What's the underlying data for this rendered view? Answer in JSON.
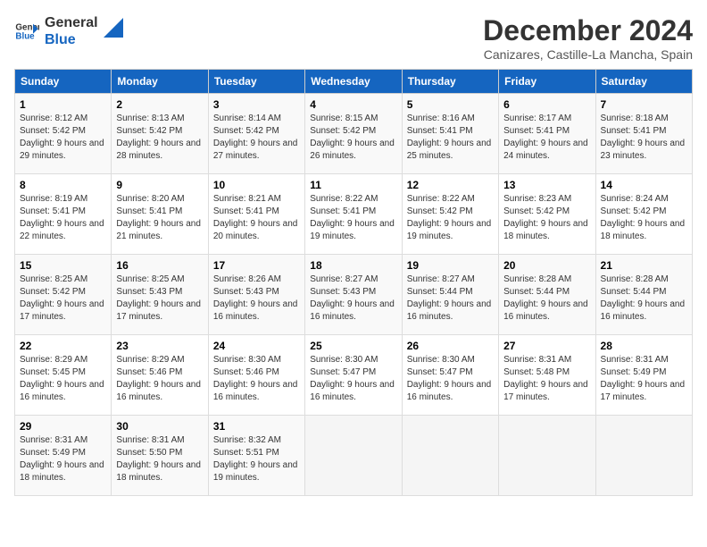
{
  "logo": {
    "line1": "General",
    "line2": "Blue"
  },
  "title": "December 2024",
  "subtitle": "Canizares, Castille-La Mancha, Spain",
  "days_header": [
    "Sunday",
    "Monday",
    "Tuesday",
    "Wednesday",
    "Thursday",
    "Friday",
    "Saturday"
  ],
  "weeks": [
    [
      {
        "day": "1",
        "sr": "8:12 AM",
        "ss": "5:42 PM",
        "dl": "9 hours and 29 minutes."
      },
      {
        "day": "2",
        "sr": "8:13 AM",
        "ss": "5:42 PM",
        "dl": "9 hours and 28 minutes."
      },
      {
        "day": "3",
        "sr": "8:14 AM",
        "ss": "5:42 PM",
        "dl": "9 hours and 27 minutes."
      },
      {
        "day": "4",
        "sr": "8:15 AM",
        "ss": "5:42 PM",
        "dl": "9 hours and 26 minutes."
      },
      {
        "day": "5",
        "sr": "8:16 AM",
        "ss": "5:41 PM",
        "dl": "9 hours and 25 minutes."
      },
      {
        "day": "6",
        "sr": "8:17 AM",
        "ss": "5:41 PM",
        "dl": "9 hours and 24 minutes."
      },
      {
        "day": "7",
        "sr": "8:18 AM",
        "ss": "5:41 PM",
        "dl": "9 hours and 23 minutes."
      }
    ],
    [
      {
        "day": "8",
        "sr": "8:19 AM",
        "ss": "5:41 PM",
        "dl": "9 hours and 22 minutes."
      },
      {
        "day": "9",
        "sr": "8:20 AM",
        "ss": "5:41 PM",
        "dl": "9 hours and 21 minutes."
      },
      {
        "day": "10",
        "sr": "8:21 AM",
        "ss": "5:41 PM",
        "dl": "9 hours and 20 minutes."
      },
      {
        "day": "11",
        "sr": "8:22 AM",
        "ss": "5:41 PM",
        "dl": "9 hours and 19 minutes."
      },
      {
        "day": "12",
        "sr": "8:22 AM",
        "ss": "5:42 PM",
        "dl": "9 hours and 19 minutes."
      },
      {
        "day": "13",
        "sr": "8:23 AM",
        "ss": "5:42 PM",
        "dl": "9 hours and 18 minutes."
      },
      {
        "day": "14",
        "sr": "8:24 AM",
        "ss": "5:42 PM",
        "dl": "9 hours and 18 minutes."
      }
    ],
    [
      {
        "day": "15",
        "sr": "8:25 AM",
        "ss": "5:42 PM",
        "dl": "9 hours and 17 minutes."
      },
      {
        "day": "16",
        "sr": "8:25 AM",
        "ss": "5:43 PM",
        "dl": "9 hours and 17 minutes."
      },
      {
        "day": "17",
        "sr": "8:26 AM",
        "ss": "5:43 PM",
        "dl": "9 hours and 16 minutes."
      },
      {
        "day": "18",
        "sr": "8:27 AM",
        "ss": "5:43 PM",
        "dl": "9 hours and 16 minutes."
      },
      {
        "day": "19",
        "sr": "8:27 AM",
        "ss": "5:44 PM",
        "dl": "9 hours and 16 minutes."
      },
      {
        "day": "20",
        "sr": "8:28 AM",
        "ss": "5:44 PM",
        "dl": "9 hours and 16 minutes."
      },
      {
        "day": "21",
        "sr": "8:28 AM",
        "ss": "5:44 PM",
        "dl": "9 hours and 16 minutes."
      }
    ],
    [
      {
        "day": "22",
        "sr": "8:29 AM",
        "ss": "5:45 PM",
        "dl": "9 hours and 16 minutes."
      },
      {
        "day": "23",
        "sr": "8:29 AM",
        "ss": "5:46 PM",
        "dl": "9 hours and 16 minutes."
      },
      {
        "day": "24",
        "sr": "8:30 AM",
        "ss": "5:46 PM",
        "dl": "9 hours and 16 minutes."
      },
      {
        "day": "25",
        "sr": "8:30 AM",
        "ss": "5:47 PM",
        "dl": "9 hours and 16 minutes."
      },
      {
        "day": "26",
        "sr": "8:30 AM",
        "ss": "5:47 PM",
        "dl": "9 hours and 16 minutes."
      },
      {
        "day": "27",
        "sr": "8:31 AM",
        "ss": "5:48 PM",
        "dl": "9 hours and 17 minutes."
      },
      {
        "day": "28",
        "sr": "8:31 AM",
        "ss": "5:49 PM",
        "dl": "9 hours and 17 minutes."
      }
    ],
    [
      {
        "day": "29",
        "sr": "8:31 AM",
        "ss": "5:49 PM",
        "dl": "9 hours and 18 minutes."
      },
      {
        "day": "30",
        "sr": "8:31 AM",
        "ss": "5:50 PM",
        "dl": "9 hours and 18 minutes."
      },
      {
        "day": "31",
        "sr": "8:32 AM",
        "ss": "5:51 PM",
        "dl": "9 hours and 19 minutes."
      },
      null,
      null,
      null,
      null
    ]
  ],
  "labels": {
    "sunrise": "Sunrise:",
    "sunset": "Sunset:",
    "daylight": "Daylight:"
  }
}
